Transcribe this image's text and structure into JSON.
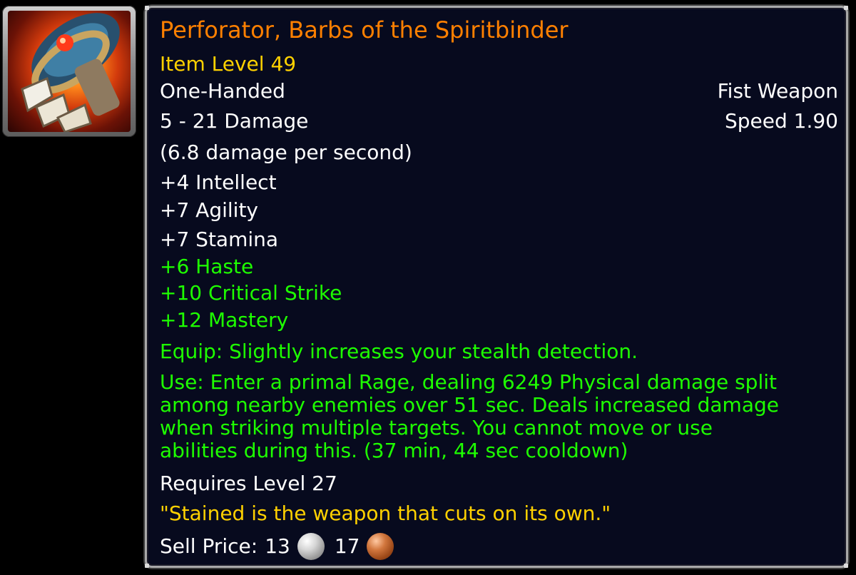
{
  "item": {
    "name": "Perforator, Barbs of the Spiritbinder",
    "item_level": "Item Level 49",
    "hand": "One-Handed",
    "type": "Fist Weapon",
    "damage": "5 - 21 Damage",
    "speed": "Speed 1.90",
    "dps": "(6.8 damage per second)"
  },
  "stats": {
    "primary": [
      "+4 Intellect",
      "+7 Agility",
      "+7 Stamina"
    ],
    "secondary": [
      "+6 Haste",
      "+10 Critical Strike",
      "+12 Mastery"
    ]
  },
  "effects": {
    "equip": "Equip: Slightly increases your stealth detection.",
    "use_lines": [
      "Use: Enter a primal Rage, dealing 6249 Physical damage split",
      "among nearby enemies over 51 sec. Deals increased damage",
      "when striking multiple targets. You cannot move or use",
      "abilities during this. (37 min, 44 sec cooldown)"
    ]
  },
  "requirements": {
    "level": "Requires Level 27"
  },
  "flavor": "\"Stained is the weapon that cuts on its own.\"",
  "sell_price": {
    "label": "Sell Price:",
    "silver": "13",
    "copper": "17"
  },
  "colors": {
    "legendary_orange": "#ff8000",
    "gold": "#ffd100",
    "green": "#1eff00",
    "white": "#ffffff",
    "tooltip_bg": "#070a1e"
  },
  "icons": {
    "item": "fist-weapon-item-icon",
    "silver": "silver-coin-icon",
    "copper": "copper-coin-icon"
  }
}
